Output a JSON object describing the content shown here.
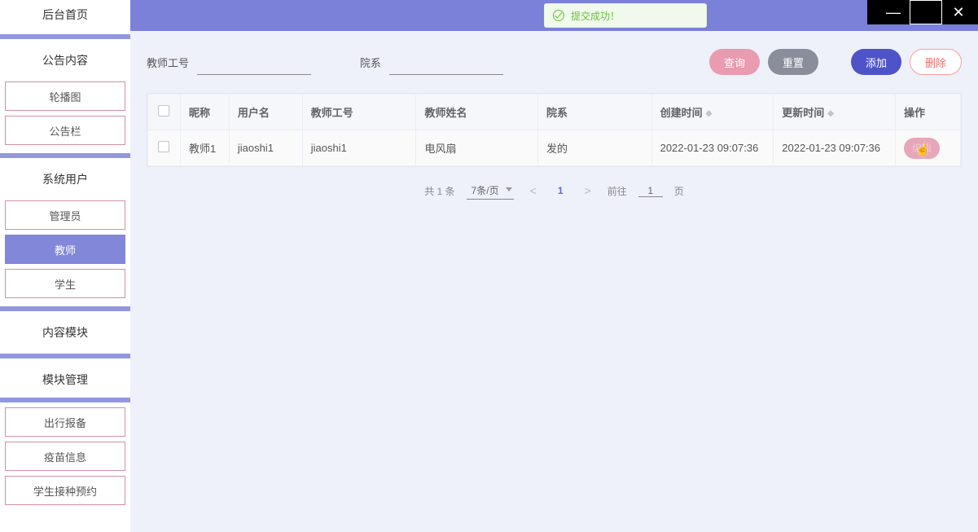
{
  "toast": {
    "text": "提交成功！"
  },
  "window": {
    "minimize": "—",
    "maximize": "☐",
    "close": "✕"
  },
  "sidebar": {
    "sections": [
      {
        "title": "后台首页",
        "items": []
      },
      {
        "title": "公告内容",
        "items": [
          {
            "label": "轮播图",
            "active": false
          },
          {
            "label": "公告栏",
            "active": false
          }
        ]
      },
      {
        "title": "系统用户",
        "items": [
          {
            "label": "管理员",
            "active": false
          },
          {
            "label": "教师",
            "active": true
          },
          {
            "label": "学生",
            "active": false
          }
        ]
      },
      {
        "title": "内容模块",
        "items": []
      },
      {
        "title": "模块管理",
        "items": [
          {
            "label": "出行报备",
            "active": false
          },
          {
            "label": "疫苗信息",
            "active": false
          },
          {
            "label": "学生接种预约",
            "active": false
          }
        ]
      }
    ]
  },
  "filters": {
    "teacher_id": {
      "label": "教师工号",
      "value": ""
    },
    "department": {
      "label": "院系",
      "value": ""
    }
  },
  "buttons": {
    "query": "查询",
    "reset": "重置",
    "add": "添加",
    "delete": "删除"
  },
  "table": {
    "columns": [
      "",
      "昵称",
      "用户名",
      "教师工号",
      "教师姓名",
      "院系",
      "创建时间",
      "更新时间",
      "操作"
    ],
    "sortable": [
      false,
      false,
      false,
      false,
      false,
      false,
      true,
      true,
      false
    ],
    "rows": [
      {
        "nickname": "教师1",
        "username": "jiaoshi1",
        "teacher_id": "jiaoshi1",
        "teacher_name": "电风扇",
        "department": "发的",
        "created": "2022-01-23 09:07:36",
        "updated": "2022-01-23 09:07:36",
        "action": "编辑"
      }
    ]
  },
  "pagination": {
    "total_label": "共 1 条",
    "page_size": "7条/页",
    "current": "1",
    "goto_label_pre": "前往",
    "goto_value": "1",
    "goto_label_post": "页"
  }
}
